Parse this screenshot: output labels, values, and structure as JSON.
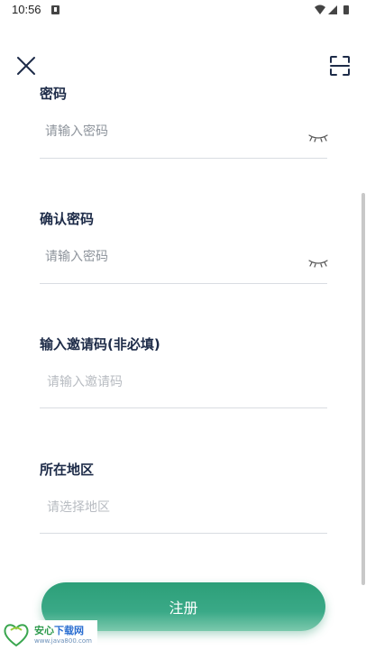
{
  "status_bar": {
    "time": "10:56"
  },
  "form": {
    "password": {
      "label": "密码",
      "placeholder": "请输入密码"
    },
    "confirm_password": {
      "label": "确认密码",
      "placeholder": "请输入密码"
    },
    "invite_code": {
      "label": "输入邀请码(非必填)",
      "placeholder": "请输入邀请码"
    },
    "region": {
      "label": "所在地区",
      "placeholder": "请选择地区"
    }
  },
  "register_button": {
    "label": "注册"
  },
  "watermark": {
    "title_green": "安心",
    "title_blue": "下载网",
    "url": "www.java800.com"
  },
  "colors": {
    "accent": "#2c9f78",
    "label": "#1d2b48",
    "divider": "#d9dde2"
  }
}
